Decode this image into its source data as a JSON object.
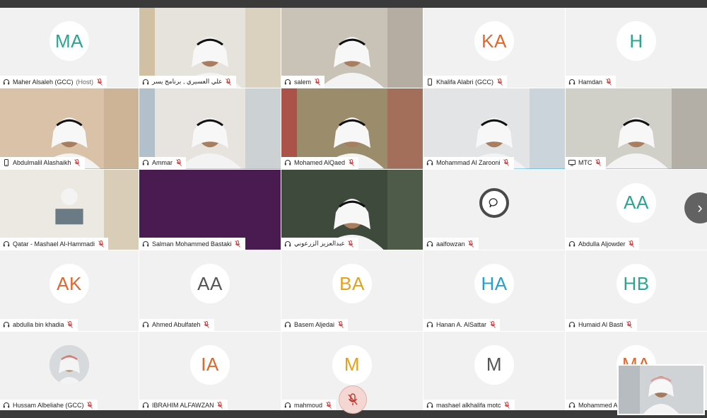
{
  "colors": {
    "accent_selected": "#3ab0e0",
    "mic_muted": "#d24040",
    "host_text": "#666666"
  },
  "participants": [
    {
      "name": "Maher Alsaleh (GCC)",
      "suffix": "(Host)",
      "initials": "MA",
      "initials_color": "#2aa58f",
      "device": "headset-icon",
      "video": false
    },
    {
      "name": "علي العسيري , برنامج يسر",
      "initials": "",
      "device": "headset-icon",
      "video": true
    },
    {
      "name": "salem",
      "initials": "",
      "device": "headset-icon",
      "video": true
    },
    {
      "name": "Khalifa Alabri (GCC)",
      "initials": "KA",
      "initials_color": "#e2672d",
      "device": "phone-icon",
      "video": false
    },
    {
      "name": "Hamdan",
      "initials": "H",
      "initials_color": "#2aa58f",
      "device": "headset-icon",
      "video": false
    },
    {
      "name": "Abdulmalil Alashaikh",
      "initials": "",
      "device": "phone-icon",
      "video": true
    },
    {
      "name": "Ammar",
      "initials": "",
      "device": "headset-icon",
      "video": true
    },
    {
      "name": "Mohamed AlQaed",
      "initials": "",
      "device": "headset-icon",
      "video": true
    },
    {
      "name": "Mohammad Al Zarooni",
      "initials": "",
      "device": "headset-icon",
      "video": true,
      "selected": true
    },
    {
      "name": "MTC",
      "initials": "",
      "device": "monitor-icon",
      "video": true
    },
    {
      "name": "Qatar - Mashael Al-Hammadi",
      "initials": "",
      "device": "headset-icon",
      "video": true
    },
    {
      "name": "Salman Mohammed Bastaki",
      "initials": "",
      "device": "headset-icon",
      "video": true
    },
    {
      "name": "عبدالعزيز الزرعوني",
      "initials": "",
      "device": "headset-icon",
      "video": true
    },
    {
      "name": "aalfowzan",
      "initials": "",
      "device": "headset-icon",
      "video": false,
      "speaking": true
    },
    {
      "name": "Abdulla Aljowder",
      "initials": "AA",
      "initials_color": "#2aa58f",
      "device": "headset-icon",
      "video": false
    },
    {
      "name": "abdulla bin khadia",
      "initials": "AK",
      "initials_color": "#e2672d",
      "device": "headset-icon",
      "video": false
    },
    {
      "name": "Ahmed Abulfateh",
      "initials": "AA",
      "initials_color": "#555555",
      "device": "headset-icon",
      "video": false
    },
    {
      "name": "Basem Aljedai",
      "initials": "BA",
      "initials_color": "#e3a21a",
      "device": "headset-icon",
      "video": false
    },
    {
      "name": "Hanan A. AlSattar",
      "initials": "HA",
      "initials_color": "#2b9ed0",
      "device": "headset-icon",
      "video": false
    },
    {
      "name": "Humaid Al Basti",
      "initials": "HB",
      "initials_color": "#2aa58f",
      "device": "headset-icon",
      "video": false
    },
    {
      "name": "Hussam Albeliahe (GCC)",
      "initials": "",
      "device": "headset-icon",
      "video": false,
      "photo": true
    },
    {
      "name": "IBRAHIM ALFAWZAN",
      "initials": "IA",
      "initials_color": "#e2672d",
      "device": "headset-icon",
      "video": false
    },
    {
      "name": "mahmoud",
      "initials": "M",
      "initials_color": "#e3a21a",
      "device": "headset-icon",
      "video": false
    },
    {
      "name": "mashael alkhalifa motc",
      "initials": "M",
      "initials_color": "#555555",
      "device": "headset-icon",
      "video": false
    },
    {
      "name": "Mohammed A",
      "initials": "MA",
      "initials_color": "#e2672d",
      "device": "headset-icon",
      "video": false
    }
  ],
  "controls": {
    "next_page_glyph": "›",
    "mic_button_icon": "mic-off-icon",
    "speaking_icon": "speech-bubble-icon"
  }
}
